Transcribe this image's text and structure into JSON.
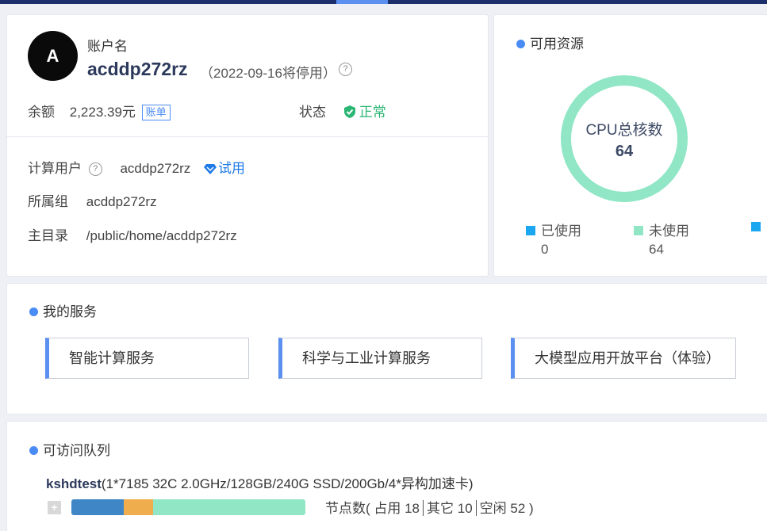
{
  "account": {
    "avatar_letter": "A",
    "label": "账户名",
    "name": "acddp272rz",
    "expire_note": "（2022-09-16将停用）",
    "balance_label": "余额",
    "balance_value": "2,223.39元",
    "bill_label": "账单",
    "status_label": "状态",
    "status_value": "正常",
    "compute_user_label": "计算用户",
    "compute_user_value": "acddp272rz",
    "trial_label": "试用",
    "group_label": "所属组",
    "group_value": "acddp272rz",
    "home_label": "主目录",
    "home_value": "/public/home/acddp272rz"
  },
  "resources": {
    "title": "可用资源",
    "donut_label": "CPU总核数",
    "donut_value": "64",
    "used_fraction": 0,
    "legend": [
      {
        "label": "已使用",
        "value": "0",
        "color": "#1aa7f0"
      },
      {
        "label": "未使用",
        "value": "64",
        "color": "#90e6c5"
      },
      {
        "label": "",
        "value": "",
        "color": "#1aa7f0"
      }
    ]
  },
  "services": {
    "title": "我的服务",
    "items": [
      {
        "label": "智能计算服务"
      },
      {
        "label": "科学与工业计算服务"
      },
      {
        "label": "大模型应用开放平台（体验）"
      }
    ]
  },
  "queues": {
    "title": "可访问队列",
    "items": [
      {
        "name": "kshdtest",
        "spec": "(1*7185 32C 2.0GHz/128GB/240G SSD/200Gb/4*异构加速卡)",
        "expand_label": "+",
        "stats_prefix": "节点数( 占用 18",
        "stats_other": "其它 10",
        "stats_idle": "空闲 52 )",
        "occupied": 18,
        "other": 10,
        "idle": 52,
        "colors": {
          "occupied": "#3f86c6",
          "other": "#f0ad4e",
          "idle": "#90e6c5"
        }
      }
    ]
  }
}
